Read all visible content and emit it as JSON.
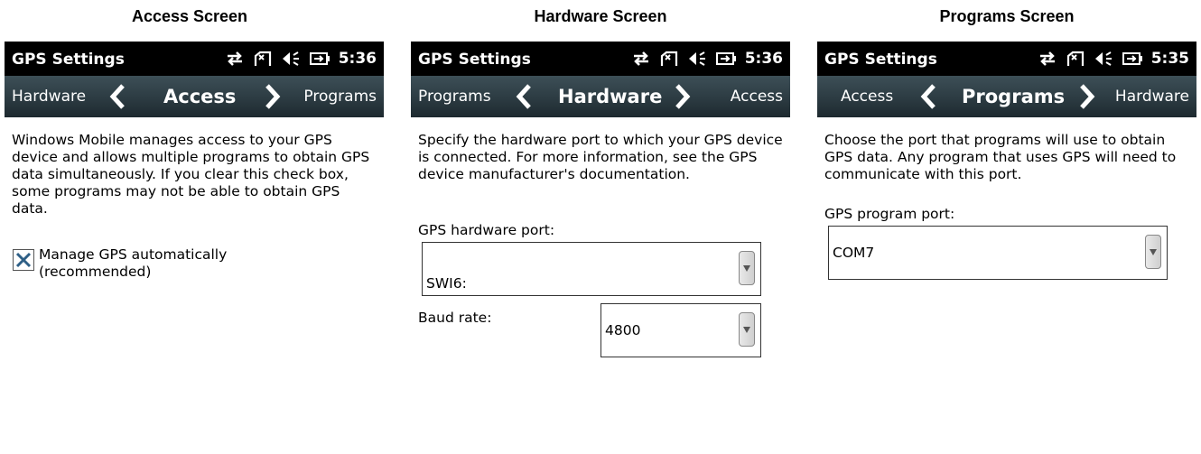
{
  "captions": [
    "Access Screen",
    "Hardware Screen",
    "Programs Screen"
  ],
  "status": {
    "title": "GPS Settings",
    "icons": [
      "data-sync-icon",
      "wifi-icon",
      "speaker-icon",
      "battery-icon"
    ]
  },
  "access": {
    "clock": "5:36",
    "nav_prev": "Hardware",
    "nav_current": "Access",
    "nav_next": "Programs",
    "description": "Windows Mobile manages access to your GPS device and allows multiple programs to obtain GPS data simultaneously. If you clear this check box, some programs may not be able to obtain GPS data.",
    "checkbox_line1": "Manage GPS automatically",
    "checkbox_line2": "(recommended)",
    "checkbox_checked": true
  },
  "hardware": {
    "clock": "5:36",
    "nav_prev": "Programs",
    "nav_current": "Hardware",
    "nav_next": "Access",
    "description": "Specify the hardware port to which your GPS device is connected. For more information, see the GPS device manufacturer's documentation.",
    "port_label": "GPS hardware port:",
    "port_value": "SWI6:",
    "baud_label": "Baud rate:",
    "baud_value": "4800"
  },
  "programs": {
    "clock": "5:35",
    "nav_prev": "Access",
    "nav_current": "Programs",
    "nav_next": "Hardware",
    "description": "Choose the port that programs will use to obtain GPS data. Any program that uses GPS will need to communicate with this port.",
    "port_label": "GPS program port:",
    "port_value": "COM7"
  }
}
